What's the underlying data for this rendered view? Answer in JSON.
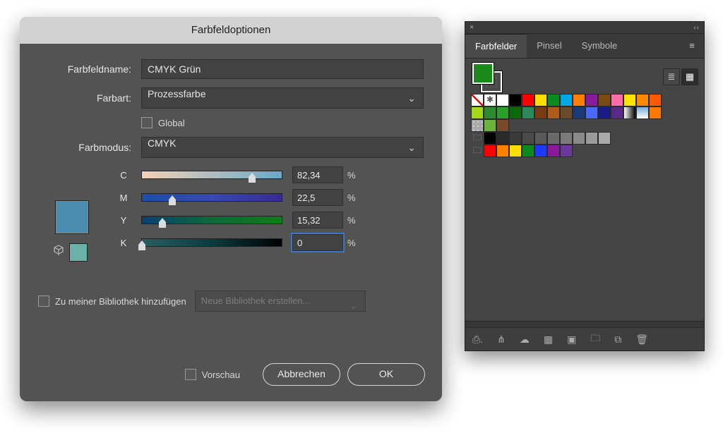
{
  "dialog": {
    "title": "Farbfeldoptionen",
    "name_label": "Farbfeldname:",
    "name_value": "CMYK Grün",
    "type_label": "Farbart:",
    "type_value": "Prozessfarbe",
    "global_label": "Global",
    "mode_label": "Farbmodus:",
    "mode_value": "CMYK",
    "channels": [
      {
        "label": "C",
        "value": "82,34",
        "pct": 82.34,
        "grad": "linear-gradient(to right,#f3d1b8,#6aa9c9)"
      },
      {
        "label": "M",
        "value": "22,5",
        "pct": 22.5,
        "grad": "linear-gradient(to right,#1a4fa9,#3848b5,#3a2a95)"
      },
      {
        "label": "Y",
        "value": "15,32",
        "pct": 15.32,
        "grad": "linear-gradient(to right,#0b3f6f,#0e6a3b,#0f7d15)"
      },
      {
        "label": "K",
        "value": "0",
        "pct": 0,
        "grad": "linear-gradient(to right,#2a5e62,#0c3b3d,#000)"
      }
    ],
    "lib_label": "Zu meiner Bibliothek hinzufügen",
    "lib_select": "Neue Bibliothek erstellen...",
    "preview_label": "Vorschau",
    "cancel": "Abbrechen",
    "ok": "OK",
    "percent": "%"
  },
  "panel": {
    "tabs": [
      "Farbfelder",
      "Pinsel",
      "Symbole"
    ],
    "row1": [
      "none",
      "reg",
      "#ffffff",
      "#000000",
      "#ff0000",
      "#ffde00",
      "#0a8a1f",
      "#00a9e6",
      "#ff7f00",
      "#8a1a9c",
      "#7a4a12",
      "#ff6aa8",
      "#ffe400",
      "#ff8a00",
      "#ff5a00"
    ],
    "row2": [
      "#a6d81a",
      "#2d8a2d",
      "#2aa02a",
      "#0a6a0a",
      "#2a8a5a",
      "#7a3a12",
      "#b05a1a",
      "#6a4a2a",
      "#1a3a7a",
      "#4a6aff",
      "#1a1a8a",
      "#5a2a8a",
      "grad-bw",
      "grad-cy",
      "#ff7a00"
    ],
    "row3": [
      "check",
      "#6ab43a",
      "#7a4a2a"
    ],
    "row4": [
      "folder",
      "#000000",
      "#2a2a2a",
      "#3a3a3a",
      "#4a4a4a",
      "#5a5a5a",
      "#6a6a6a",
      "#7a7a7a",
      "#8a8a8a",
      "#9a9a9a",
      "#aaaaaa"
    ],
    "row5": [
      "folder",
      "#ff0000",
      "#ff7f00",
      "#ffde00",
      "#0a8a1f",
      "#1a3aff",
      "#8a1a9c",
      "#6a3a9a"
    ]
  }
}
